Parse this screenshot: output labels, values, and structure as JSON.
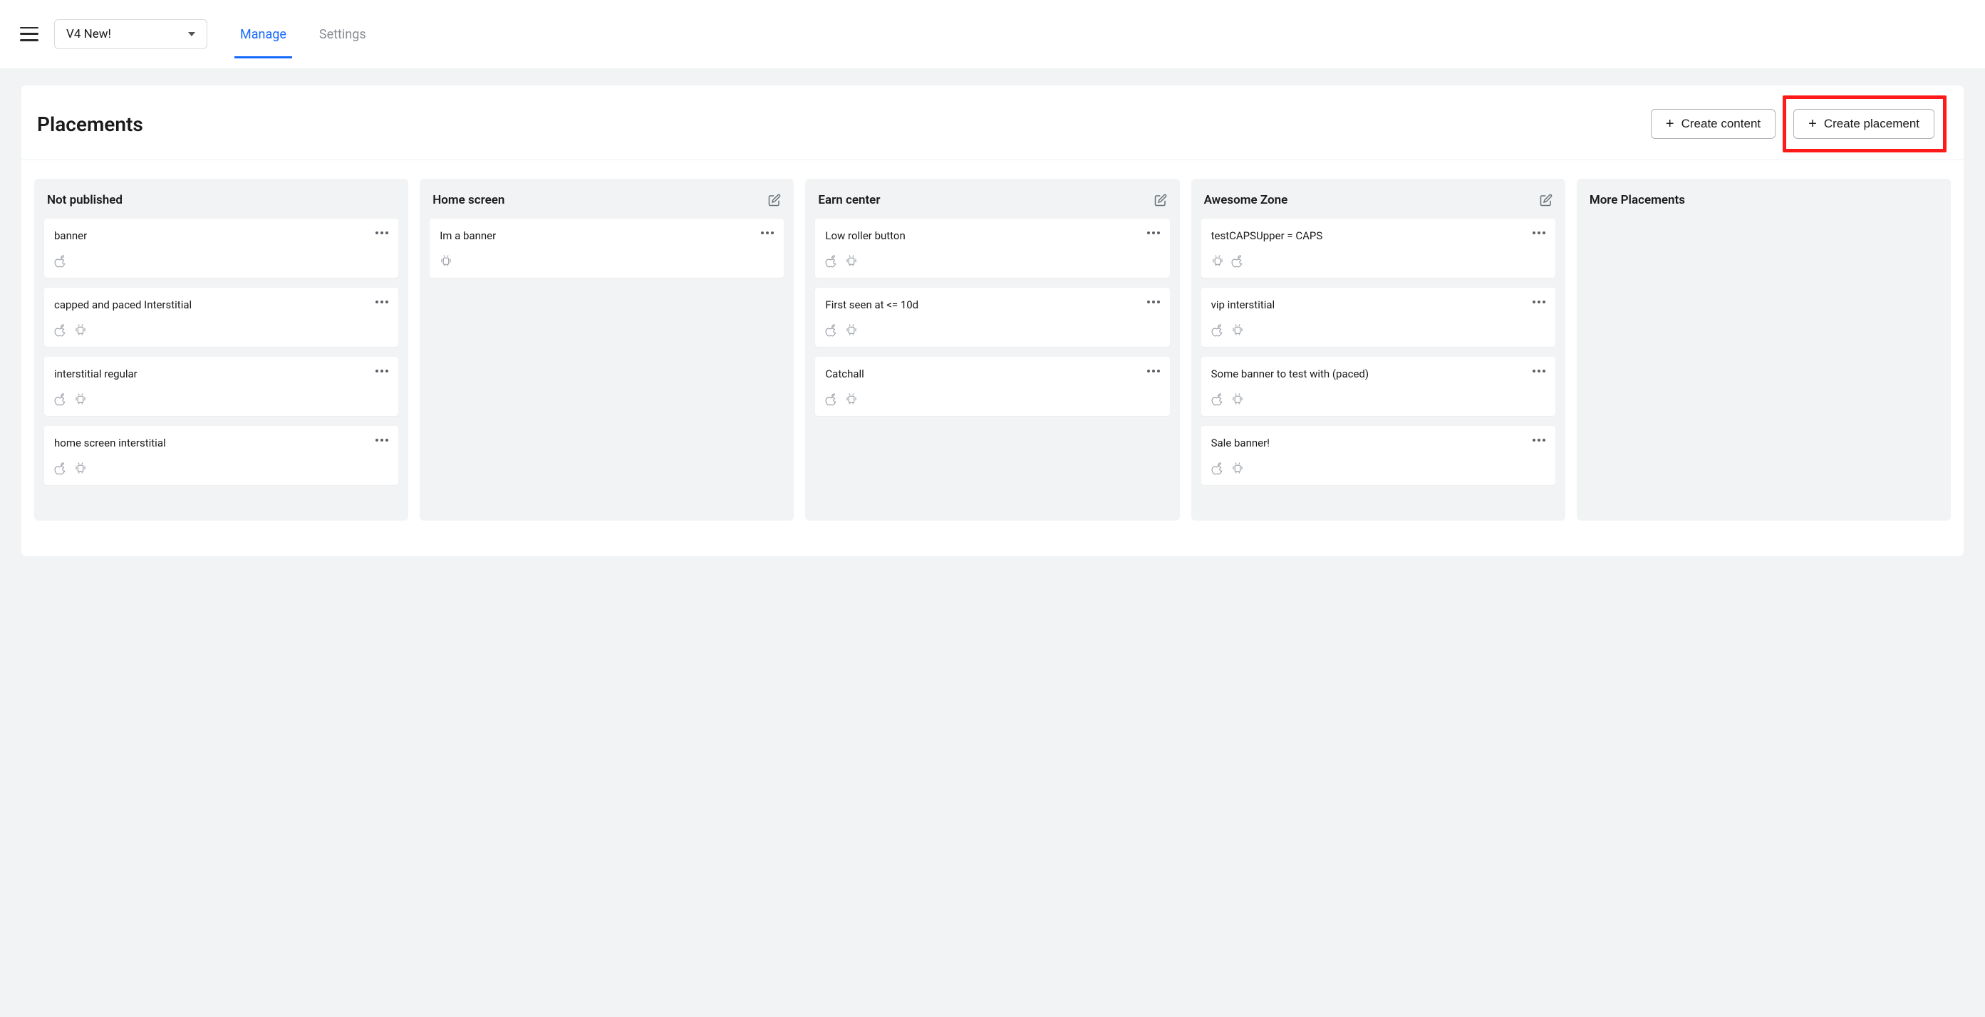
{
  "header": {
    "project_name": "V4 New!",
    "tabs": {
      "manage": "Manage",
      "settings": "Settings"
    }
  },
  "panel": {
    "title": "Placements",
    "create_content_label": "Create content",
    "create_placement_label": "Create placement"
  },
  "columns": [
    {
      "title": "Not published",
      "editable": false,
      "cards": [
        {
          "title": "banner",
          "platforms": [
            "apple"
          ]
        },
        {
          "title": "capped and paced Interstitial",
          "platforms": [
            "apple",
            "android"
          ]
        },
        {
          "title": "interstitial regular",
          "platforms": [
            "apple",
            "android"
          ]
        },
        {
          "title": "home screen interstitial",
          "platforms": [
            "apple",
            "android"
          ]
        }
      ]
    },
    {
      "title": "Home screen",
      "editable": true,
      "cards": [
        {
          "title": "Im a banner",
          "platforms": [
            "android"
          ]
        }
      ]
    },
    {
      "title": "Earn center",
      "editable": true,
      "cards": [
        {
          "title": "Low roller button",
          "platforms": [
            "apple",
            "android"
          ]
        },
        {
          "title": "First seen at <= 10d",
          "platforms": [
            "apple",
            "android"
          ]
        },
        {
          "title": "Catchall",
          "platforms": [
            "apple",
            "android"
          ]
        }
      ]
    },
    {
      "title": "Awesome Zone",
      "editable": true,
      "cards": [
        {
          "title": "testCAPSUpper = CAPS",
          "platforms": [
            "android",
            "apple"
          ]
        },
        {
          "title": "vip interstitial",
          "platforms": [
            "apple",
            "android"
          ]
        },
        {
          "title": "Some banner to test with (paced)",
          "platforms": [
            "apple",
            "android"
          ]
        },
        {
          "title": "Sale banner!",
          "platforms": [
            "apple",
            "android"
          ]
        }
      ]
    },
    {
      "title": "More Placements",
      "editable": false,
      "cards": []
    }
  ]
}
